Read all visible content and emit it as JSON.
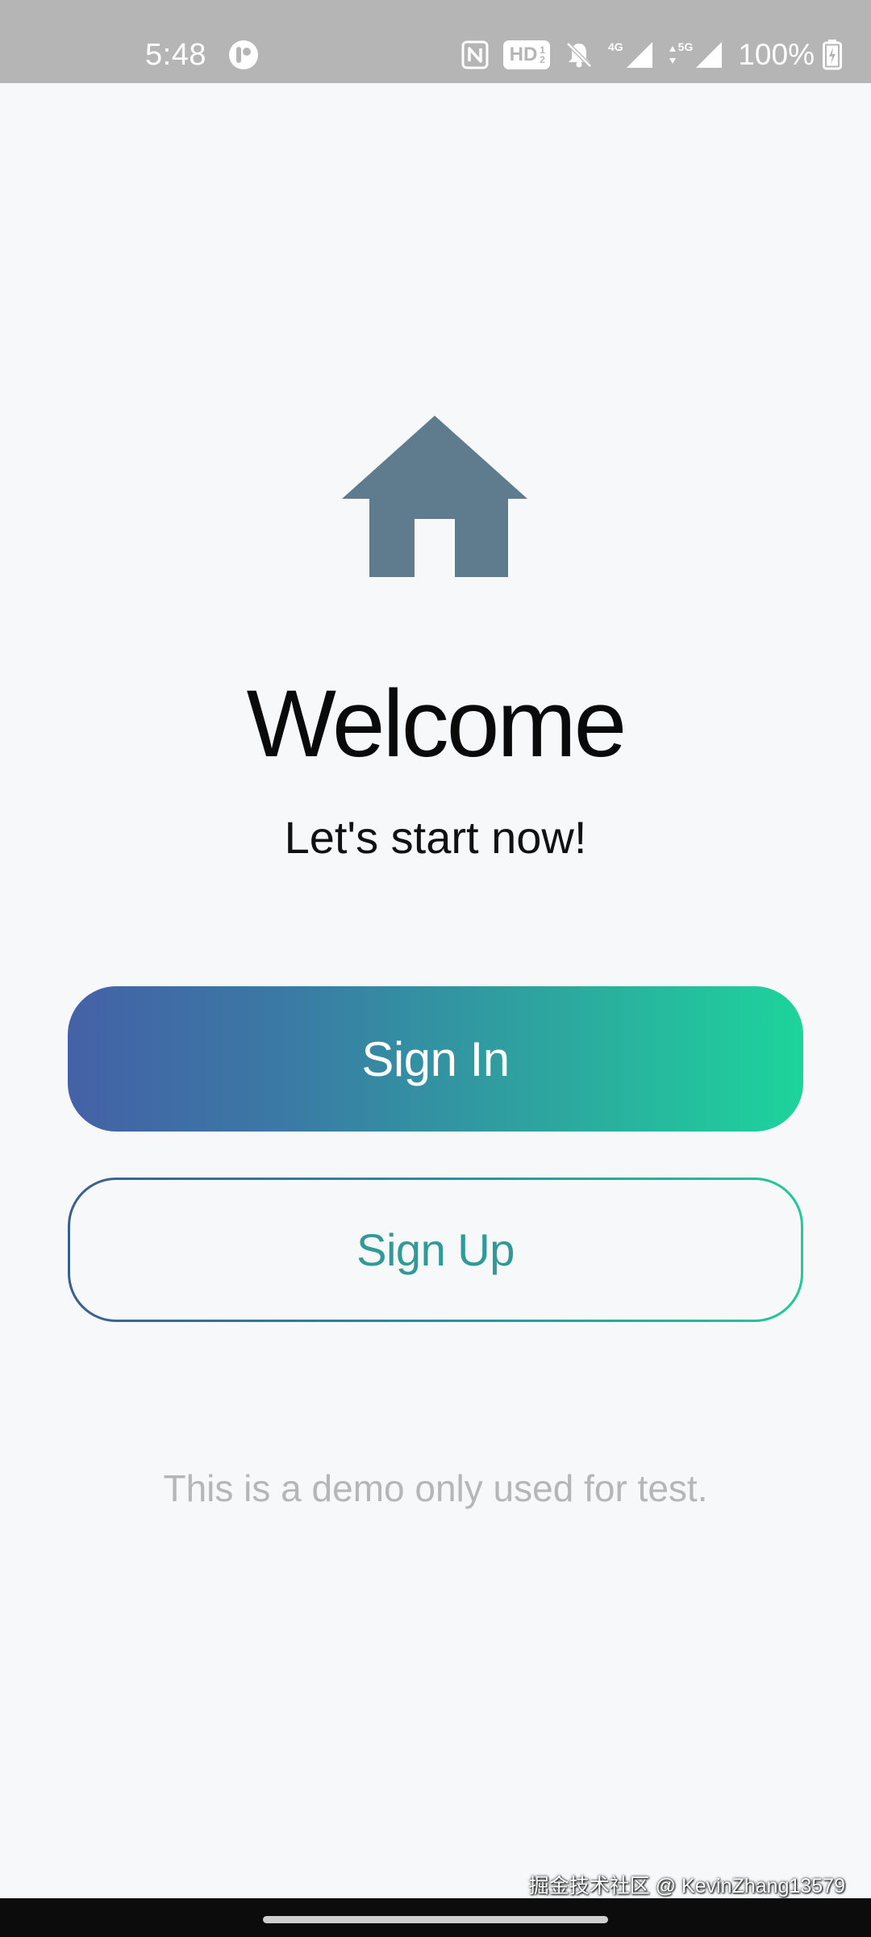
{
  "status_bar": {
    "time": "5:48",
    "hd_label": "HD",
    "hd_frac_top": "1",
    "hd_frac_bottom": "2",
    "net_label_1": "4G",
    "net_label_2": "5G",
    "battery": "100%"
  },
  "main": {
    "icon": "home-icon",
    "title": "Welcome",
    "subtitle": "Let's start now!",
    "sign_in_label": "Sign In",
    "sign_up_label": "Sign Up",
    "disclaimer": "This is a demo only used for test."
  },
  "watermark": "掘金技术社区 @ KevinZhang13579",
  "colors": {
    "icon": "#5e7c8d",
    "gradient_start": "#4461a6",
    "gradient_end": "#1dd49c",
    "sign_up_text": "#2f9a98"
  }
}
